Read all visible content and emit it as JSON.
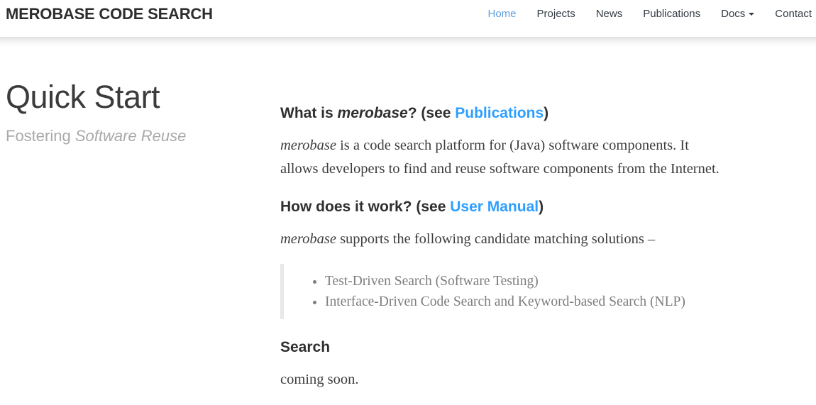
{
  "header": {
    "brand": "MEROBASE CODE SEARCH",
    "nav": [
      {
        "label": "Home",
        "active": true
      },
      {
        "label": "Projects",
        "active": false
      },
      {
        "label": "News",
        "active": false
      },
      {
        "label": "Publications",
        "active": false
      },
      {
        "label": "Docs",
        "active": false,
        "has_dropdown": true
      },
      {
        "label": "Contact",
        "active": false
      }
    ]
  },
  "sidebar": {
    "title": "Quick Start",
    "tagline_prefix": "Fostering ",
    "tagline_emphasis": "Software Reuse"
  },
  "main": {
    "what_section": {
      "heading_prefix": "What is ",
      "heading_em": "merobase",
      "heading_mid": "? (see ",
      "heading_link": "Publications",
      "heading_suffix": ")",
      "body_em": "merobase",
      "body_line1": " is a code search platform for (Java) software components. It",
      "body_line2": "allows developers to find and reuse software components from the Internet."
    },
    "how_section": {
      "heading_prefix": "How does it work? (see ",
      "heading_link": "User Manual",
      "heading_suffix": ")",
      "body_em": "merobase",
      "body_text": " supports the following candidate matching solutions –",
      "list": [
        "Test-Driven Search (Software Testing)",
        "Interface-Driven Code Search and Keyword-based Search (NLP)"
      ]
    },
    "search_section": {
      "heading": "Search",
      "body": "coming soon."
    }
  },
  "colors": {
    "link_blue": "#2e9fff",
    "nav_active_blue": "#5f9fe0",
    "heading_dark": "#2f2f2f",
    "body_text": "#3d3d3d",
    "quote_gray": "#7d7d7d",
    "tagline_gray": "#a9a9a9",
    "divider_gray": "#e0e0e0"
  }
}
